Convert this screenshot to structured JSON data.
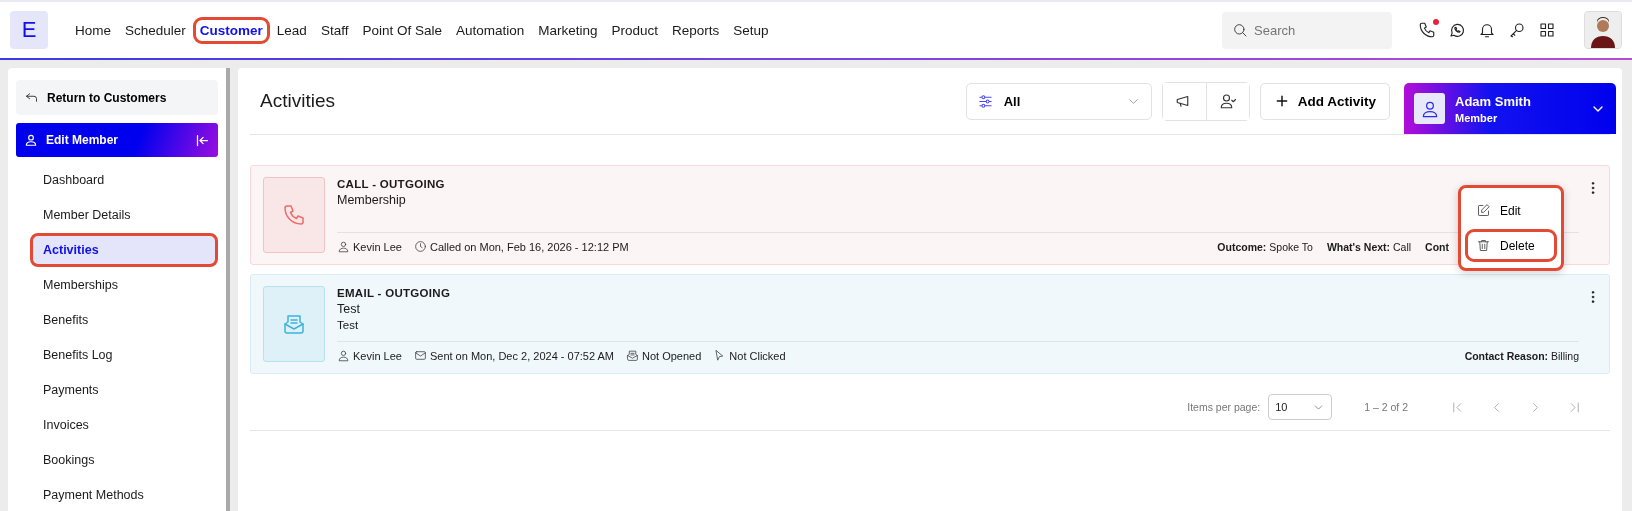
{
  "logo": "E",
  "nav": [
    {
      "label": "Home",
      "selected": false,
      "highlighted": false
    },
    {
      "label": "Scheduler",
      "selected": false,
      "highlighted": false
    },
    {
      "label": "Customer",
      "selected": true,
      "highlighted": true
    },
    {
      "label": "Lead",
      "selected": false,
      "highlighted": false
    },
    {
      "label": "Staff",
      "selected": false,
      "highlighted": false
    },
    {
      "label": "Point Of Sale",
      "selected": false,
      "highlighted": false
    },
    {
      "label": "Automation",
      "selected": false,
      "highlighted": false
    },
    {
      "label": "Marketing",
      "selected": false,
      "highlighted": false
    },
    {
      "label": "Product",
      "selected": false,
      "highlighted": false
    },
    {
      "label": "Reports",
      "selected": false,
      "highlighted": false
    },
    {
      "label": "Setup",
      "selected": false,
      "highlighted": false
    }
  ],
  "search": {
    "placeholder": "Search"
  },
  "missed_call_dot": true,
  "sidebar": {
    "return_label": "Return to Customers",
    "section_title": "Edit Member",
    "items": [
      {
        "label": "Dashboard",
        "selected": false,
        "highlighted": false
      },
      {
        "label": "Member Details",
        "selected": false,
        "highlighted": false
      },
      {
        "label": "Activities",
        "selected": true,
        "highlighted": true
      },
      {
        "label": "Memberships",
        "selected": false,
        "highlighted": false
      },
      {
        "label": "Benefits",
        "selected": false,
        "highlighted": false
      },
      {
        "label": "Benefits Log",
        "selected": false,
        "highlighted": false
      },
      {
        "label": "Payments",
        "selected": false,
        "highlighted": false
      },
      {
        "label": "Invoices",
        "selected": false,
        "highlighted": false
      },
      {
        "label": "Bookings",
        "selected": false,
        "highlighted": false
      },
      {
        "label": "Payment Methods",
        "selected": false,
        "highlighted": false
      }
    ]
  },
  "page_title": "Activities",
  "filter": {
    "value": "All"
  },
  "add_button": "Add Activity",
  "member": {
    "name": "Adam Smith",
    "role": "Member"
  },
  "activities": [
    {
      "kind": "call",
      "title": "CALL - OUTGOING",
      "subject": "Membership",
      "staff": "Kevin Lee",
      "when": "Called on Mon, Feb 16, 2026 - 12:12 PM",
      "details": [
        {
          "label": "Outcome:",
          "value": "Spoke To"
        },
        {
          "label": "What's Next:",
          "value": "Call"
        },
        {
          "label": "Cont"
        }
      ],
      "menu_open": true
    },
    {
      "kind": "email",
      "title": "EMAIL - OUTGOING",
      "subject": "Test",
      "note": "Test",
      "staff": "Kevin Lee",
      "when": "Sent on Mon, Dec 2, 2024 - 07:52 AM",
      "tracking": [
        {
          "kind": "opened",
          "label": "Not Opened"
        },
        {
          "kind": "clicked",
          "label": "Not Clicked"
        }
      ],
      "details": [
        {
          "label": "Contact Reason:",
          "value": "Billing"
        }
      ],
      "menu_open": false
    }
  ],
  "menu": {
    "items": [
      {
        "kind": "edit",
        "label": "Edit",
        "highlighted": false
      },
      {
        "kind": "delete",
        "label": "Delete",
        "highlighted": true
      }
    ],
    "highlighted": true
  },
  "pagination": {
    "label": "Items per page:",
    "page_size": "10",
    "range": "1 – 2 of 2"
  }
}
